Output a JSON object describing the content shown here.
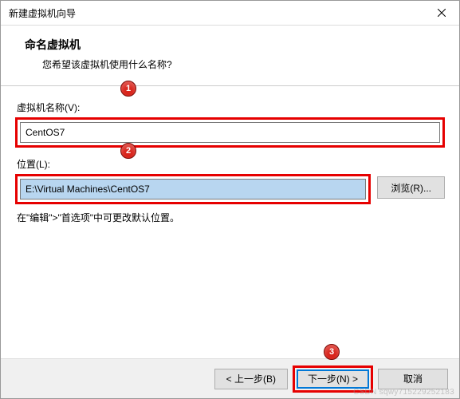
{
  "titlebar": {
    "text": "新建虚拟机向导"
  },
  "header": {
    "title": "命名虚拟机",
    "subtitle": "您希望该虚拟机使用什么名称?"
  },
  "fields": {
    "name_label": "虚拟机名称(V):",
    "name_value": "CentOS7",
    "location_label": "位置(L):",
    "location_value": "E:\\Virtual Machines\\CentOS7",
    "browse_label": "浏览(R)...",
    "hint": "在\"编辑\">\"首选项\"中可更改默认位置。"
  },
  "callouts": {
    "c1": "1",
    "c2": "2",
    "c3": "3"
  },
  "footer": {
    "back": "< 上一步(B)",
    "next": "下一步(N) >",
    "cancel": "取消"
  },
  "watermark": "CSDN  sqwy715229252183"
}
